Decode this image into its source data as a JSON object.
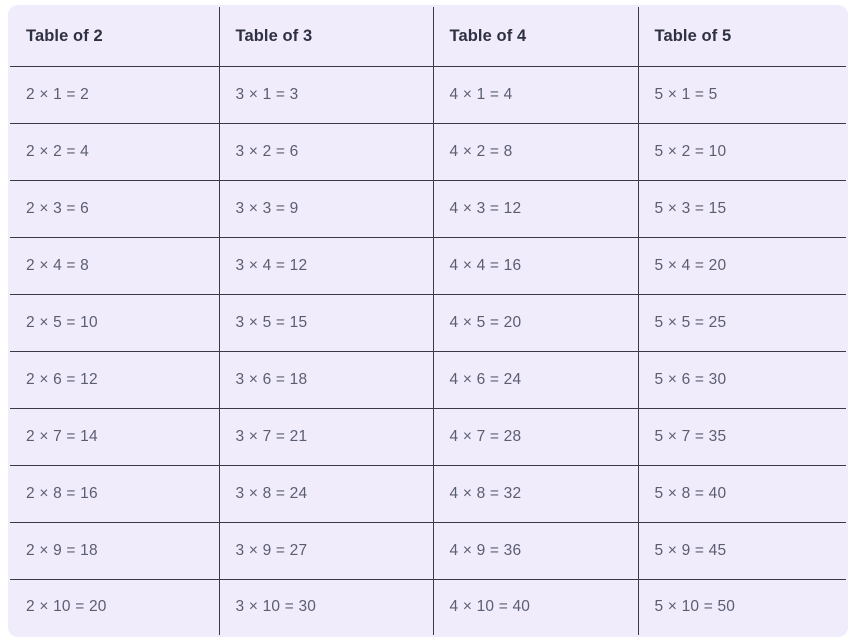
{
  "table": {
    "headers": [
      "Table of 2",
      "Table of 3",
      "Table of 4",
      "Table of 5"
    ],
    "rows": [
      [
        "2 × 1 = 2",
        "3 × 1 = 3",
        "4 × 1 = 4",
        "5 × 1 = 5"
      ],
      [
        "2 × 2 = 4",
        "3 × 2 = 6",
        "4 × 2 = 8",
        "5 × 2 = 10"
      ],
      [
        "2 × 3 = 6",
        "3 × 3 = 9",
        "4 × 3 = 12",
        "5 × 3 = 15"
      ],
      [
        "2 × 4 = 8",
        "3 × 4 = 12",
        "4 × 4 = 16",
        "5 × 4 = 20"
      ],
      [
        "2 × 5 = 10",
        "3 × 5 = 15",
        "4 × 5 = 20",
        "5 × 5 = 25"
      ],
      [
        "2 × 6 = 12",
        "3 × 6 = 18",
        "4 × 6 = 24",
        "5 × 6 = 30"
      ],
      [
        "2 × 7 = 14",
        "3 × 7 = 21",
        "4 × 7 = 28",
        "5 × 7 = 35"
      ],
      [
        "2 × 8 = 16",
        "3 × 8 = 24",
        "4 × 8 = 32",
        "5 × 8 = 40"
      ],
      [
        "2 × 9 = 18",
        "3 × 9 = 27",
        "4 × 9 = 36",
        "5 × 9 = 45"
      ],
      [
        "2 × 10 = 20",
        "3 × 10 = 30",
        "4 × 10 = 40",
        "5 × 10 = 50"
      ]
    ]
  },
  "colors": {
    "cell_background": "#f0ecfb",
    "border": "#3a3a44",
    "header_text": "#2e3043",
    "body_text": "#5b5d73",
    "page_background": "#ffffff"
  }
}
